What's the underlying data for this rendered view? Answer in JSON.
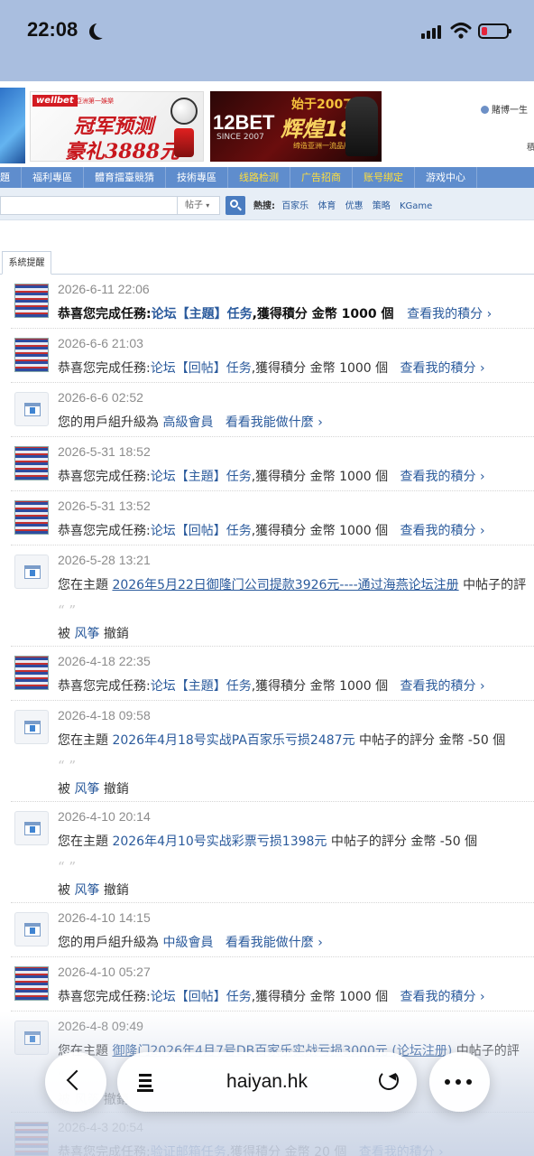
{
  "status_bar": {
    "time": "22:08"
  },
  "banners": {
    "wellbet_logo": "wellbet",
    "wellbet_sub": "亞洲第一娛樂",
    "wellbet_line1": "冠军预测",
    "wellbet_line2": "豪礼3888元",
    "bet12_logo": "12BET",
    "bet12_sub": "SINCE 2007",
    "bet12_line1": "始于2007",
    "bet12_line2": "辉煌18年",
    "bet12_line3": "缔造亚洲一流品牌"
  },
  "user_area": {
    "name": "賭博一生",
    "sub": "積"
  },
  "nav": {
    "items": [
      "題",
      "福利專區",
      "體育擂臺競猜",
      "技術專區",
      "线路检测",
      "广告招商",
      "账号绑定",
      "游戏中心"
    ]
  },
  "search": {
    "type_select": "帖子",
    "hot_label": "熱搜:",
    "hot_links": [
      "百家乐",
      "体育",
      "优惠",
      "策略",
      "KGame"
    ]
  },
  "tabs": {
    "active": "系統提醒"
  },
  "feed": [
    {
      "kind": "task",
      "avatar": "user",
      "date": "2026-6-11 22:06",
      "bold": true,
      "prefix": "恭喜您完成任務:",
      "task": "论坛【主題】任务",
      "reward": ",獲得積分 金幣 1000 個",
      "link": "查看我的積分 ›"
    },
    {
      "kind": "task",
      "avatar": "user",
      "date": "2026-6-6 21:03",
      "bold": false,
      "prefix": "恭喜您完成任務:",
      "task": "论坛【回帖】任务",
      "reward": ",獲得積分 金幣 1000 個",
      "link": "查看我的積分 ›"
    },
    {
      "kind": "group",
      "avatar": "notice",
      "date": "2026-6-6 02:52",
      "prefix": "您的用戶組升級為",
      "group": "高級會員",
      "link": "看看我能做什麼 ›"
    },
    {
      "kind": "task",
      "avatar": "user",
      "date": "2026-5-31 18:52",
      "bold": false,
      "prefix": "恭喜您完成任務:",
      "task": "论坛【主題】任务",
      "reward": ",獲得積分 金幣 1000 個",
      "link": "查看我的積分 ›"
    },
    {
      "kind": "task",
      "avatar": "user",
      "date": "2026-5-31 13:52",
      "bold": false,
      "prefix": "恭喜您完成任務:",
      "task": "论坛【回帖】任务",
      "reward": ",獲得積分 金幣 1000 個",
      "link": "查看我的積分 ›"
    },
    {
      "kind": "rate",
      "avatar": "notice",
      "date": "2026-5-28 13:21",
      "prefix": "您在主題",
      "topic": "2026年5月22日御隆门公司提款3926元----通过海燕论坛注册",
      "suffix": "中帖子的評",
      "underline": true,
      "quote": "“ ”",
      "revoked_prefix": "被",
      "revoked_by": "风筝",
      "revoked_suffix": "撤銷"
    },
    {
      "kind": "task",
      "avatar": "user",
      "date": "2026-4-18 22:35",
      "bold": false,
      "prefix": "恭喜您完成任務:",
      "task": "论坛【主題】任务",
      "reward": ",獲得積分 金幣 1000 個",
      "link": "查看我的積分 ›"
    },
    {
      "kind": "rate",
      "avatar": "notice",
      "date": "2026-4-18 09:58",
      "prefix": "您在主題",
      "topic": "2026年4月18号实战PA百家乐亏损2487元",
      "suffix": "中帖子的評分 金幣 -50 個",
      "underline": false,
      "quote": "“ ”",
      "revoked_prefix": "被",
      "revoked_by": "风筝",
      "revoked_suffix": "撤銷"
    },
    {
      "kind": "rate",
      "avatar": "notice",
      "date": "2026-4-10 20:14",
      "prefix": "您在主題",
      "topic": "2026年4月10号实战彩票亏损1398元",
      "suffix": "中帖子的評分 金幣 -50 個",
      "underline": false,
      "quote": "“ ”",
      "revoked_prefix": "被",
      "revoked_by": "风筝",
      "revoked_suffix": "撤銷"
    },
    {
      "kind": "group",
      "avatar": "notice",
      "date": "2026-4-10 14:15",
      "prefix": "您的用戶組升級為",
      "group": "中級會員",
      "link": "看看我能做什麼 ›"
    },
    {
      "kind": "task",
      "avatar": "user",
      "date": "2026-4-10 05:27",
      "bold": false,
      "prefix": "恭喜您完成任務:",
      "task": "论坛【回帖】任务",
      "reward": ",獲得積分 金幣 1000 個",
      "link": "查看我的積分 ›"
    },
    {
      "kind": "rate",
      "avatar": "notice",
      "date": "2026-4-8 09:49",
      "prefix": "您在主題",
      "topic": "御隆门2026年4月7号DB百家乐实战亏损3000元 (论坛注册)",
      "suffix": "中帖子的評",
      "underline": true,
      "quote": "“ ”",
      "revoked_prefix": "被",
      "revoked_by": "风筝",
      "revoked_suffix": "撤銷"
    },
    {
      "kind": "task",
      "avatar": "user",
      "date": "2026-4-3 20:54",
      "bold": false,
      "prefix": "恭喜您完成任務:",
      "task": "验证邮箱任务",
      "reward": ",獲得積分 金幣 20 個",
      "link": "查看我的積分 ›"
    }
  ],
  "browser": {
    "url": "haiyan.hk"
  }
}
